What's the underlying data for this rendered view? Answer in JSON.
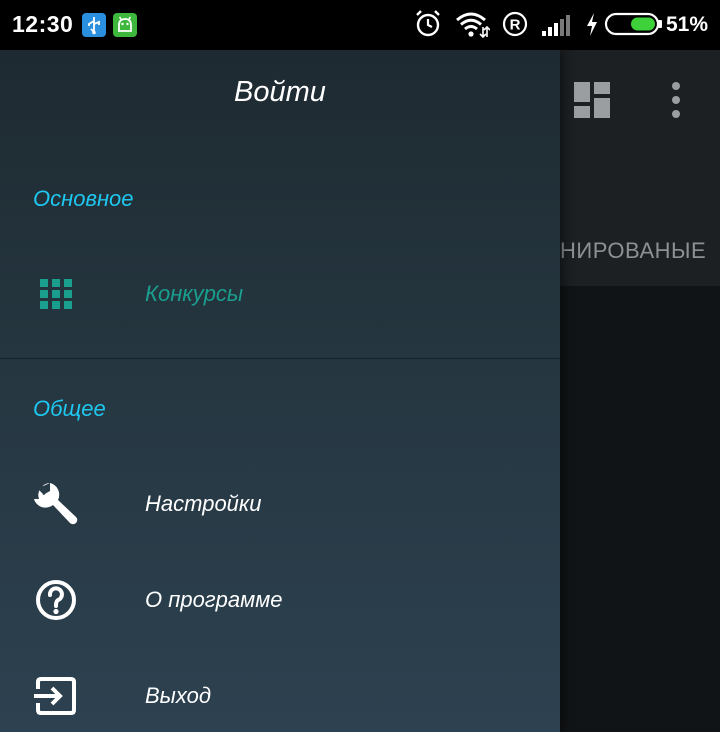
{
  "status_bar": {
    "time": "12:30",
    "battery_percent": "51%",
    "battery_level": 0.51,
    "icons": [
      "usb-debug-icon",
      "android-icon",
      "alarm-icon",
      "wifi-icon",
      "registered-icon",
      "signal-icon",
      "charging-icon",
      "battery-icon"
    ]
  },
  "background": {
    "tab_label": "НИРОВАНЫЕ",
    "icons": [
      "dashboard-icon",
      "overflow-menu-icon"
    ]
  },
  "drawer": {
    "login": "Войти",
    "sections": [
      {
        "title": "Основное",
        "items": [
          {
            "label": "Конкурсы",
            "icon": "grid-icon",
            "active": true
          }
        ]
      },
      {
        "title": "Общее",
        "items": [
          {
            "label": "Настройки",
            "icon": "wrench-icon",
            "active": false
          },
          {
            "label": "О программе",
            "icon": "help-circle-icon",
            "active": false
          },
          {
            "label": "Выход",
            "icon": "exit-icon",
            "active": false
          }
        ]
      }
    ]
  },
  "colors": {
    "accent_section": "#1fc7f0",
    "active_item": "#1a9e8e",
    "drawer_top": "#1e2a31",
    "drawer_bottom": "#2d4150"
  }
}
